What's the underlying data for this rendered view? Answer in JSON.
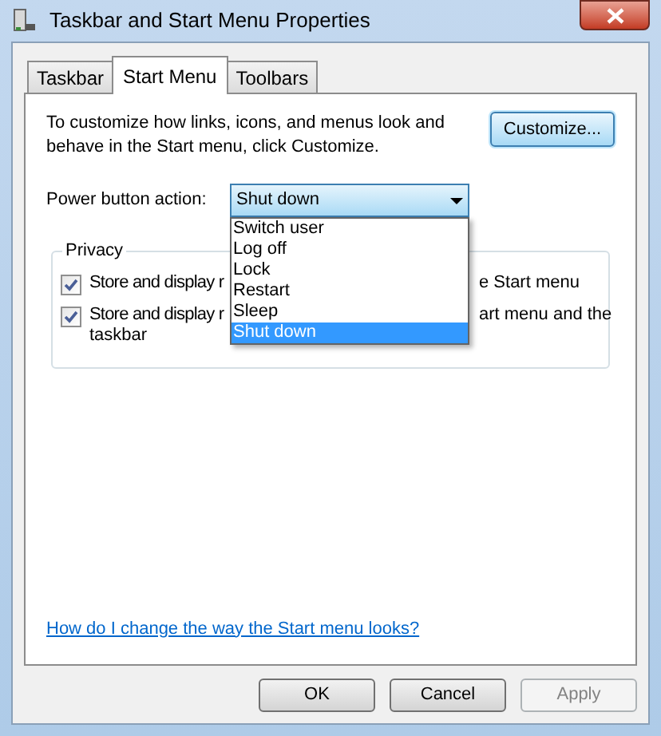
{
  "window": {
    "title": "Taskbar and Start Menu Properties"
  },
  "tabs": [
    {
      "label": "Taskbar",
      "selected": false
    },
    {
      "label": "Start Menu",
      "selected": true
    },
    {
      "label": "Toolbars",
      "selected": false
    }
  ],
  "description": "To customize how links, icons, and menus look and behave in the Start menu, click Customize.",
  "customize_button": "Customize...",
  "power_button": {
    "label": "Power button action:",
    "value": "Shut down",
    "expanded": true,
    "options": [
      {
        "label": "Switch user",
        "selected": false
      },
      {
        "label": "Log off",
        "selected": false
      },
      {
        "label": "Lock",
        "selected": false
      },
      {
        "label": "Restart",
        "selected": false
      },
      {
        "label": "Sleep",
        "selected": false
      },
      {
        "label": "Shut down",
        "selected": true
      }
    ]
  },
  "privacy": {
    "title": "Privacy",
    "items": [
      {
        "label_start": "Store and display r",
        "label_end": "e Start menu",
        "checked": true
      },
      {
        "label_start": "Store and display r",
        "label_end": "art menu and the",
        "label_line2": "taskbar",
        "checked": true
      }
    ]
  },
  "help_link": "How do I change the way the Start menu looks?",
  "buttons": [
    {
      "label": "OK",
      "disabled": false
    },
    {
      "label": "Cancel",
      "disabled": false
    },
    {
      "label": "Apply",
      "disabled": true
    }
  ]
}
